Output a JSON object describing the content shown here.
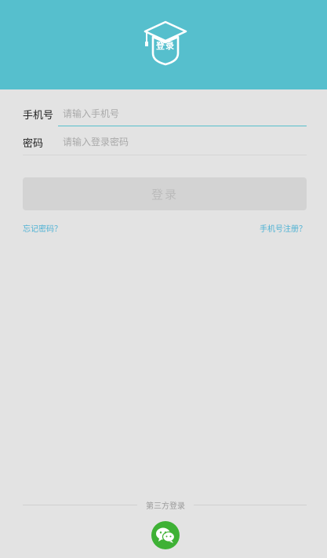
{
  "header": {
    "logo_icon": "graduation-cap-shield-icon",
    "logo_text": "登录",
    "background_color": "#56bfcd"
  },
  "form": {
    "phone_label": "手机号",
    "phone_placeholder": "请输入手机号",
    "password_label": "密码",
    "password_placeholder": "请输入登录密码",
    "accent_color": "#56bfcd"
  },
  "actions": {
    "login_label": "登录",
    "forgot_label": "忘记密码？",
    "register_label": "手机号注册？",
    "link_color": "#4fb2d4"
  },
  "third_party": {
    "label": "第三方登录",
    "wechat_icon": "wechat-icon",
    "wechat_color": "#3eb135"
  }
}
